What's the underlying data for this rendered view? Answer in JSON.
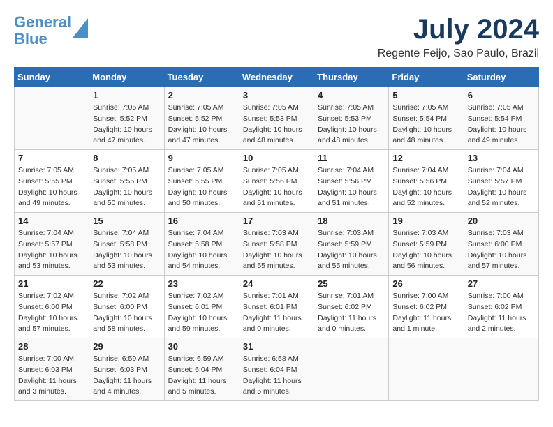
{
  "header": {
    "logo_line1": "General",
    "logo_line2": "Blue",
    "month_title": "July 2024",
    "location": "Regente Feijo, Sao Paulo, Brazil"
  },
  "days_of_week": [
    "Sunday",
    "Monday",
    "Tuesday",
    "Wednesday",
    "Thursday",
    "Friday",
    "Saturday"
  ],
  "weeks": [
    [
      {
        "num": "",
        "sunrise": "",
        "sunset": "",
        "daylight": ""
      },
      {
        "num": "1",
        "sunrise": "Sunrise: 7:05 AM",
        "sunset": "Sunset: 5:52 PM",
        "daylight": "Daylight: 10 hours and 47 minutes."
      },
      {
        "num": "2",
        "sunrise": "Sunrise: 7:05 AM",
        "sunset": "Sunset: 5:52 PM",
        "daylight": "Daylight: 10 hours and 47 minutes."
      },
      {
        "num": "3",
        "sunrise": "Sunrise: 7:05 AM",
        "sunset": "Sunset: 5:53 PM",
        "daylight": "Daylight: 10 hours and 48 minutes."
      },
      {
        "num": "4",
        "sunrise": "Sunrise: 7:05 AM",
        "sunset": "Sunset: 5:53 PM",
        "daylight": "Daylight: 10 hours and 48 minutes."
      },
      {
        "num": "5",
        "sunrise": "Sunrise: 7:05 AM",
        "sunset": "Sunset: 5:54 PM",
        "daylight": "Daylight: 10 hours and 48 minutes."
      },
      {
        "num": "6",
        "sunrise": "Sunrise: 7:05 AM",
        "sunset": "Sunset: 5:54 PM",
        "daylight": "Daylight: 10 hours and 49 minutes."
      }
    ],
    [
      {
        "num": "7",
        "sunrise": "Sunrise: 7:05 AM",
        "sunset": "Sunset: 5:55 PM",
        "daylight": "Daylight: 10 hours and 49 minutes."
      },
      {
        "num": "8",
        "sunrise": "Sunrise: 7:05 AM",
        "sunset": "Sunset: 5:55 PM",
        "daylight": "Daylight: 10 hours and 50 minutes."
      },
      {
        "num": "9",
        "sunrise": "Sunrise: 7:05 AM",
        "sunset": "Sunset: 5:55 PM",
        "daylight": "Daylight: 10 hours and 50 minutes."
      },
      {
        "num": "10",
        "sunrise": "Sunrise: 7:05 AM",
        "sunset": "Sunset: 5:56 PM",
        "daylight": "Daylight: 10 hours and 51 minutes."
      },
      {
        "num": "11",
        "sunrise": "Sunrise: 7:04 AM",
        "sunset": "Sunset: 5:56 PM",
        "daylight": "Daylight: 10 hours and 51 minutes."
      },
      {
        "num": "12",
        "sunrise": "Sunrise: 7:04 AM",
        "sunset": "Sunset: 5:56 PM",
        "daylight": "Daylight: 10 hours and 52 minutes."
      },
      {
        "num": "13",
        "sunrise": "Sunrise: 7:04 AM",
        "sunset": "Sunset: 5:57 PM",
        "daylight": "Daylight: 10 hours and 52 minutes."
      }
    ],
    [
      {
        "num": "14",
        "sunrise": "Sunrise: 7:04 AM",
        "sunset": "Sunset: 5:57 PM",
        "daylight": "Daylight: 10 hours and 53 minutes."
      },
      {
        "num": "15",
        "sunrise": "Sunrise: 7:04 AM",
        "sunset": "Sunset: 5:58 PM",
        "daylight": "Daylight: 10 hours and 53 minutes."
      },
      {
        "num": "16",
        "sunrise": "Sunrise: 7:04 AM",
        "sunset": "Sunset: 5:58 PM",
        "daylight": "Daylight: 10 hours and 54 minutes."
      },
      {
        "num": "17",
        "sunrise": "Sunrise: 7:03 AM",
        "sunset": "Sunset: 5:58 PM",
        "daylight": "Daylight: 10 hours and 55 minutes."
      },
      {
        "num": "18",
        "sunrise": "Sunrise: 7:03 AM",
        "sunset": "Sunset: 5:59 PM",
        "daylight": "Daylight: 10 hours and 55 minutes."
      },
      {
        "num": "19",
        "sunrise": "Sunrise: 7:03 AM",
        "sunset": "Sunset: 5:59 PM",
        "daylight": "Daylight: 10 hours and 56 minutes."
      },
      {
        "num": "20",
        "sunrise": "Sunrise: 7:03 AM",
        "sunset": "Sunset: 6:00 PM",
        "daylight": "Daylight: 10 hours and 57 minutes."
      }
    ],
    [
      {
        "num": "21",
        "sunrise": "Sunrise: 7:02 AM",
        "sunset": "Sunset: 6:00 PM",
        "daylight": "Daylight: 10 hours and 57 minutes."
      },
      {
        "num": "22",
        "sunrise": "Sunrise: 7:02 AM",
        "sunset": "Sunset: 6:00 PM",
        "daylight": "Daylight: 10 hours and 58 minutes."
      },
      {
        "num": "23",
        "sunrise": "Sunrise: 7:02 AM",
        "sunset": "Sunset: 6:01 PM",
        "daylight": "Daylight: 10 hours and 59 minutes."
      },
      {
        "num": "24",
        "sunrise": "Sunrise: 7:01 AM",
        "sunset": "Sunset: 6:01 PM",
        "daylight": "Daylight: 11 hours and 0 minutes."
      },
      {
        "num": "25",
        "sunrise": "Sunrise: 7:01 AM",
        "sunset": "Sunset: 6:02 PM",
        "daylight": "Daylight: 11 hours and 0 minutes."
      },
      {
        "num": "26",
        "sunrise": "Sunrise: 7:00 AM",
        "sunset": "Sunset: 6:02 PM",
        "daylight": "Daylight: 11 hours and 1 minute."
      },
      {
        "num": "27",
        "sunrise": "Sunrise: 7:00 AM",
        "sunset": "Sunset: 6:02 PM",
        "daylight": "Daylight: 11 hours and 2 minutes."
      }
    ],
    [
      {
        "num": "28",
        "sunrise": "Sunrise: 7:00 AM",
        "sunset": "Sunset: 6:03 PM",
        "daylight": "Daylight: 11 hours and 3 minutes."
      },
      {
        "num": "29",
        "sunrise": "Sunrise: 6:59 AM",
        "sunset": "Sunset: 6:03 PM",
        "daylight": "Daylight: 11 hours and 4 minutes."
      },
      {
        "num": "30",
        "sunrise": "Sunrise: 6:59 AM",
        "sunset": "Sunset: 6:04 PM",
        "daylight": "Daylight: 11 hours and 5 minutes."
      },
      {
        "num": "31",
        "sunrise": "Sunrise: 6:58 AM",
        "sunset": "Sunset: 6:04 PM",
        "daylight": "Daylight: 11 hours and 5 minutes."
      },
      {
        "num": "",
        "sunrise": "",
        "sunset": "",
        "daylight": ""
      },
      {
        "num": "",
        "sunrise": "",
        "sunset": "",
        "daylight": ""
      },
      {
        "num": "",
        "sunrise": "",
        "sunset": "",
        "daylight": ""
      }
    ]
  ]
}
